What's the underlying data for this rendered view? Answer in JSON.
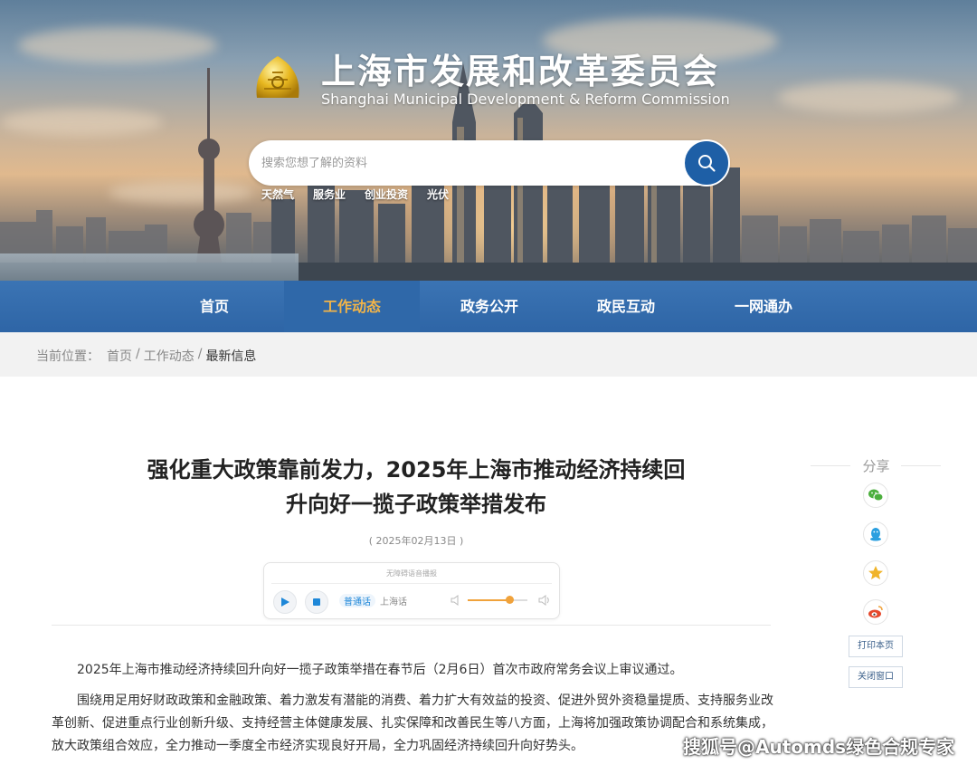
{
  "header": {
    "title": "上海市发展和改革委员会",
    "subtitle": "Shanghai Municipal Development & Reform Commission",
    "logo_icon": "shanghai-emblem-icon"
  },
  "search": {
    "placeholder": "搜索您想了解的资料",
    "button_icon": "search-icon",
    "hot_words": [
      "天然气",
      "服务业",
      "创业投资",
      "光伏"
    ]
  },
  "nav": {
    "items": [
      {
        "label": "首页"
      },
      {
        "label": "工作动态",
        "active": true
      },
      {
        "label": "政务公开"
      },
      {
        "label": "政民互动"
      },
      {
        "label": "一网通办"
      }
    ],
    "active_color": "#f2b448"
  },
  "breadcrumb": {
    "prefix": "当前位置：",
    "items": [
      "首页",
      "工作动态",
      "最新信息"
    ],
    "separator": "/"
  },
  "article": {
    "title_line1": "强化重大政策靠前发力，2025年上海市推动经济持续回",
    "title_line2": "升向好一揽子政策举措发布",
    "date": "( 2025年02月13日 )",
    "paragraphs": [
      "2025年上海市推动经济持续回升向好一揽子政策举措在春节后（2月6日）首次市政府常务会议上审议通过。",
      "围绕用足用好财政政策和金融政策、着力激发有潜能的消费、着力扩大有效益的投资、促进外贸外资稳量提质、支持服务业改革创新、促进重点行业创新升级、支持经营主体健康发展、扎实保障和改善民生等八方面，上海将加强政策协调配合和系统集成，放大政策组合效应，全力推动一季度全市经济实现良好开局，全力巩固经济持续回升向好势头。"
    ]
  },
  "audio_player": {
    "caption": "无障碍语音播报",
    "play_icon": "play-icon",
    "stop_icon": "stop-icon",
    "languages": [
      "普通话",
      "上海话"
    ],
    "selected_language": "普通话",
    "volume": 0.7,
    "accent_color": "#1e87d8",
    "volume_color": "#f0a23b"
  },
  "share": {
    "title": "分享",
    "icons": [
      {
        "name": "wechat-icon",
        "color": "#4caf3d"
      },
      {
        "name": "qq-icon",
        "color": "#2a9fe0"
      },
      {
        "name": "qzone-icon",
        "color": "#f0b429"
      },
      {
        "name": "weibo-icon",
        "color": "#e6492d"
      }
    ],
    "print_label": "打印本页",
    "close_label": "关闭窗口"
  },
  "watermark": "搜狐号@Automds绿色合规专家"
}
